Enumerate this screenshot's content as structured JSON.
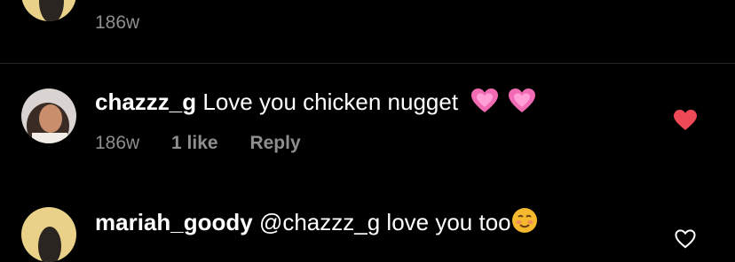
{
  "comments": [
    {
      "time": "186w"
    },
    {
      "username": "chazzz_g",
      "text": "Love you chicken nugget",
      "emojis": [
        "growing-heart-emoji",
        "growing-heart-emoji"
      ],
      "time": "186w",
      "likes": "1 like",
      "reply_label": "Reply",
      "liked": true
    },
    {
      "username": "mariah_goody",
      "mention": "@chazzz_g",
      "text": "love you too",
      "emojis": [
        "smiling-face-emoji"
      ],
      "liked": false
    }
  ],
  "colors": {
    "background": "#000000",
    "text": "#ffffff",
    "muted": "#8e8e8e",
    "divider": "#262626",
    "like_active": "#ed4956",
    "heart_emoji": "#f06ab4",
    "smile_emoji": "#f5b82e"
  }
}
